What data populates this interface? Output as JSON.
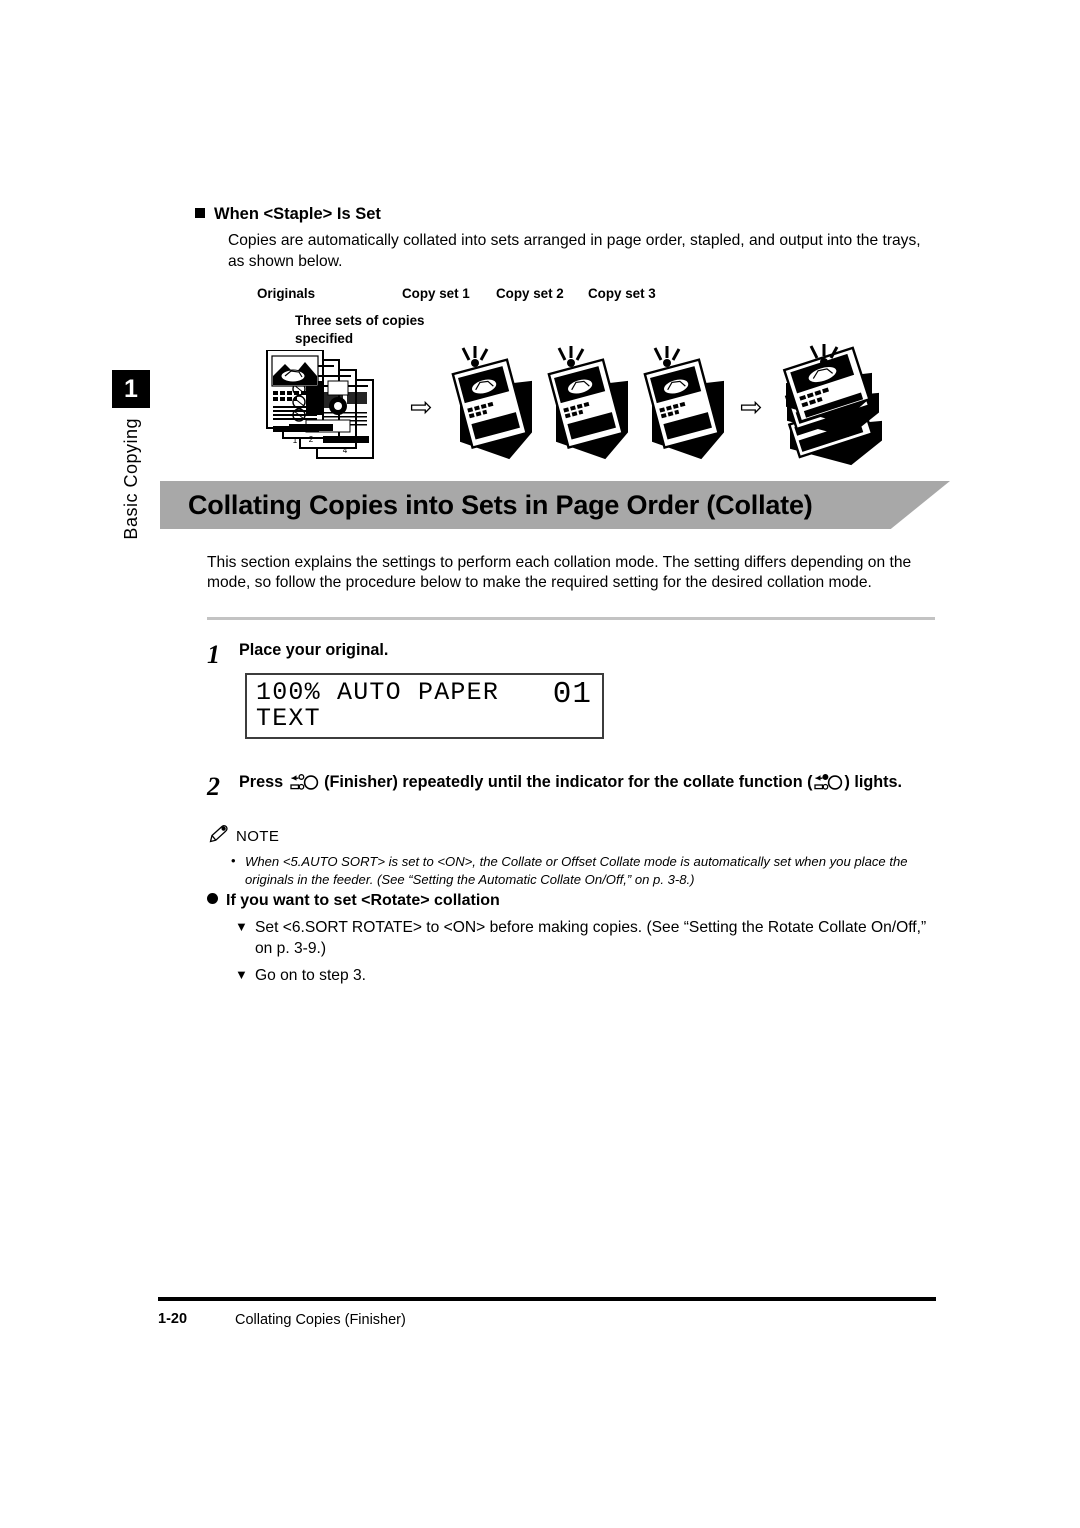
{
  "sidebar": {
    "chapter_number": "1",
    "chapter_label": "Basic Copying"
  },
  "staple_section": {
    "heading": "When <Staple> Is Set",
    "body": "Copies are automatically collated into sets arranged in page order, stapled, and output into the trays, as shown below.",
    "captions": {
      "originals": "Originals",
      "copy_set_1": "Copy set 1",
      "copy_set_2": "Copy set 2",
      "copy_set_3": "Copy set 3",
      "three_sets_line1": "Three sets of copies",
      "three_sets_line2": "specified"
    },
    "arrow_glyph": "⇨"
  },
  "banner": {
    "title": "Collating Copies into Sets in Page Order (Collate)",
    "background_color": "#a8a8a8"
  },
  "intro": "This section explains the settings to perform each collation mode. The setting differs depending on the mode, so follow the procedure below to make the required setting for the desired collation mode.",
  "steps": [
    {
      "number": "1",
      "text": "Place your original."
    },
    {
      "number": "2",
      "text_before_icon": "Press",
      "text_middle": "(Finisher) repeatedly until the indicator for the collate function (",
      "text_after": ") lights."
    }
  ],
  "lcd": {
    "line1": "100% AUTO PAPER",
    "line2": "TEXT",
    "count": "01"
  },
  "note": {
    "label": "NOTE",
    "icon": "pencil-icon",
    "items": [
      "When <5.AUTO SORT> is set to <ON>, the Collate or Offset Collate mode is automatically set when you place the originals in the feeder. (See “Setting the Automatic Collate On/Off,” on p. 3-8.)"
    ]
  },
  "rotate_section": {
    "heading": "If you want to set <Rotate> collation",
    "items": [
      "Set <6.SORT ROTATE> to <ON> before making copies. (See “Setting the Rotate Collate On/Off,” on p. 3-9.)",
      "Go on to step 3."
    ],
    "marker_glyph": "▼"
  },
  "footer": {
    "page_number": "1-20",
    "title": "Collating Copies (Finisher)"
  }
}
